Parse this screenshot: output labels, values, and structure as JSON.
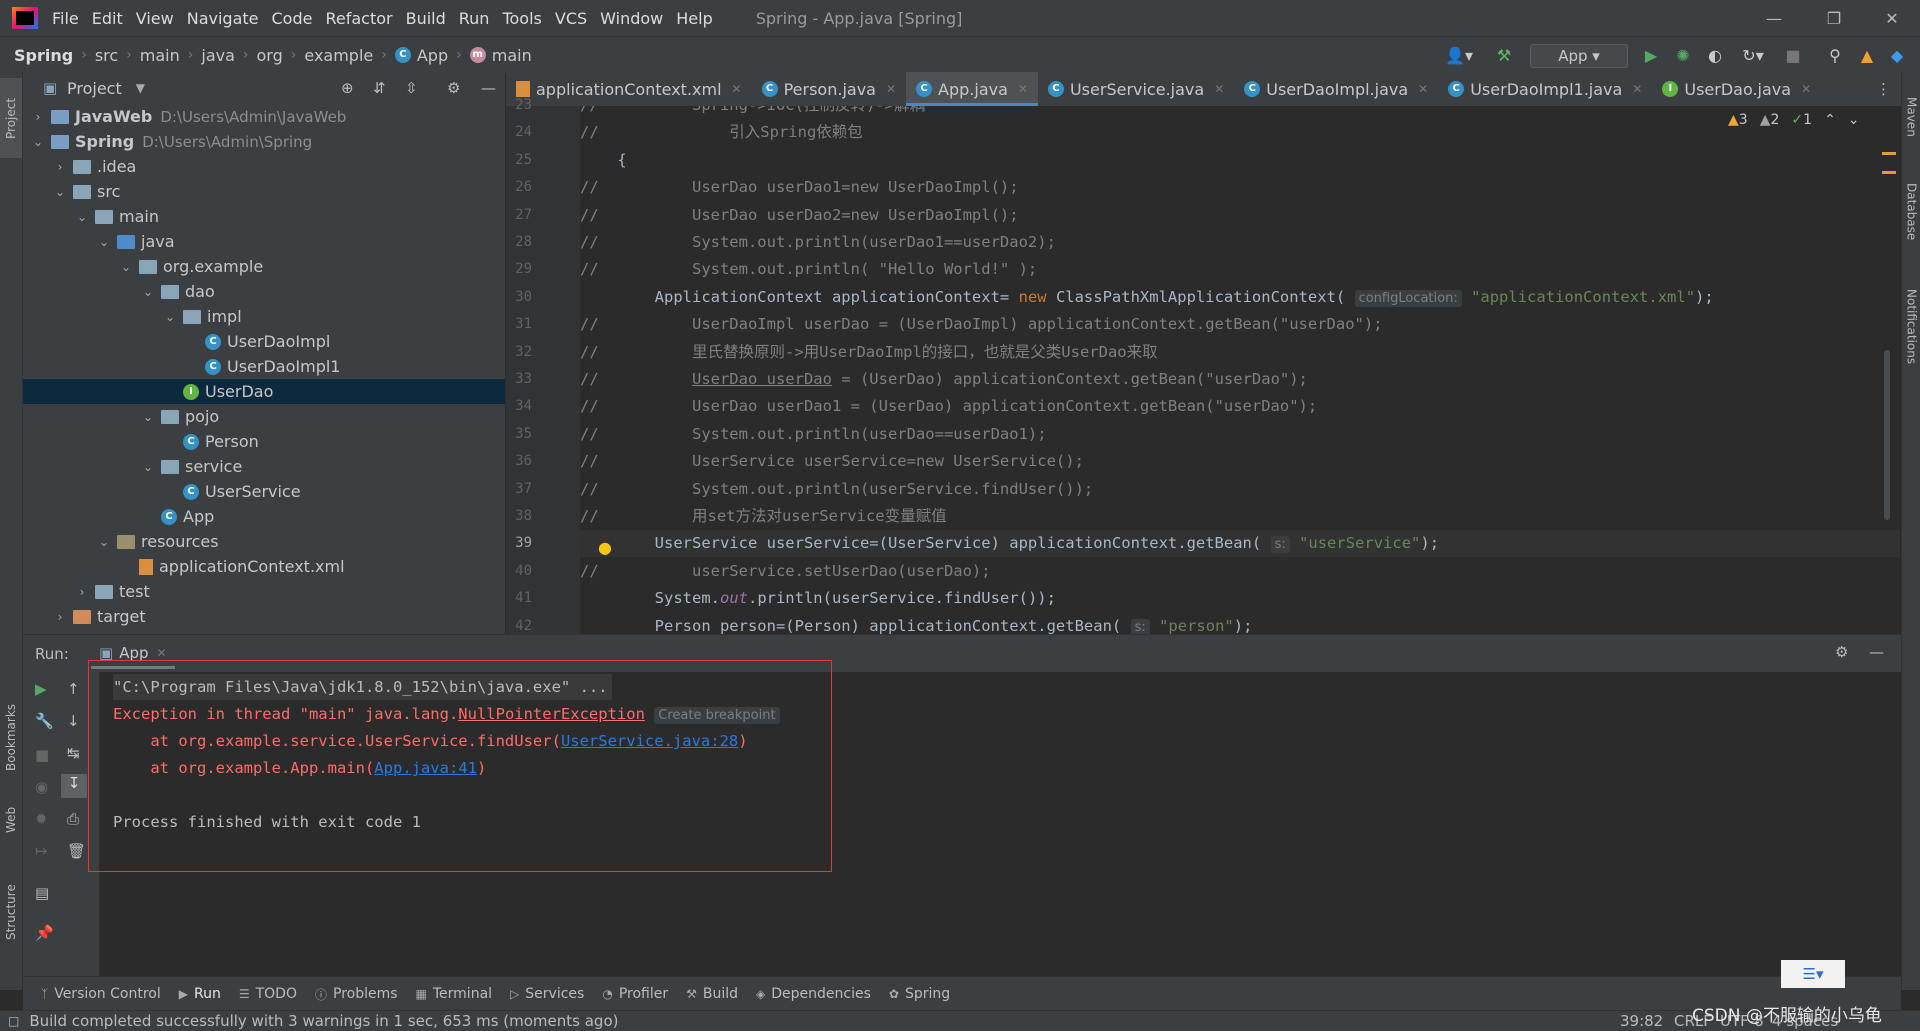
{
  "menu": [
    "File",
    "Edit",
    "View",
    "Navigate",
    "Code",
    "Refactor",
    "Build",
    "Run",
    "Tools",
    "VCS",
    "Window",
    "Help"
  ],
  "window_title": "Spring - App.java [Spring]",
  "breadcrumbs": [
    "Spring",
    "src",
    "main",
    "java",
    "org",
    "example",
    "App",
    "main"
  ],
  "run_config": "App",
  "project_panel": {
    "title": "Project",
    "tree": [
      {
        "label": "JavaWeb",
        "path": "D:\\Users\\Admin\\JavaWeb",
        "depth": 0,
        "type": "module",
        "expanded": false
      },
      {
        "label": "Spring",
        "path": "D:\\Users\\Admin\\Spring",
        "depth": 0,
        "type": "module",
        "expanded": true
      },
      {
        "label": ".idea",
        "depth": 1,
        "type": "folder",
        "expanded": false
      },
      {
        "label": "src",
        "depth": 1,
        "type": "folder",
        "expanded": true
      },
      {
        "label": "main",
        "depth": 2,
        "type": "folder",
        "expanded": true
      },
      {
        "label": "java",
        "depth": 3,
        "type": "src",
        "expanded": true
      },
      {
        "label": "org.example",
        "depth": 4,
        "type": "folder",
        "expanded": true
      },
      {
        "label": "dao",
        "depth": 5,
        "type": "folder",
        "expanded": true
      },
      {
        "label": "impl",
        "depth": 6,
        "type": "folder",
        "expanded": true
      },
      {
        "label": "UserDaoImpl",
        "depth": 7,
        "type": "class"
      },
      {
        "label": "UserDaoImpl1",
        "depth": 7,
        "type": "class"
      },
      {
        "label": "UserDao",
        "depth": 6,
        "type": "interface",
        "selected": true
      },
      {
        "label": "pojo",
        "depth": 5,
        "type": "folder",
        "expanded": true
      },
      {
        "label": "Person",
        "depth": 6,
        "type": "class"
      },
      {
        "label": "service",
        "depth": 5,
        "type": "folder",
        "expanded": true
      },
      {
        "label": "UserService",
        "depth": 6,
        "type": "class"
      },
      {
        "label": "App",
        "depth": 5,
        "type": "class"
      },
      {
        "label": "resources",
        "depth": 3,
        "type": "res",
        "expanded": true
      },
      {
        "label": "applicationContext.xml",
        "depth": 4,
        "type": "xml"
      },
      {
        "label": "test",
        "depth": 2,
        "type": "folder",
        "expanded": false
      },
      {
        "label": "target",
        "depth": 1,
        "type": "tgt",
        "expanded": false
      }
    ]
  },
  "tabs": [
    {
      "label": "applicationContext.xml",
      "icon": "xml"
    },
    {
      "label": "Person.java",
      "icon": "class"
    },
    {
      "label": "App.java",
      "icon": "class",
      "active": true
    },
    {
      "label": "UserService.java",
      "icon": "class"
    },
    {
      "label": "UserDaoImpl.java",
      "icon": "class"
    },
    {
      "label": "UserDaoImpl1.java",
      "icon": "class"
    },
    {
      "label": "UserDao.java",
      "icon": "interface"
    }
  ],
  "inspections": {
    "warnings": "3",
    "weak": "2",
    "ok": "1"
  },
  "code_lines": [
    {
      "n": "23",
      "html": "<span class=\"cm\">//          Spring->IOC(控制反转)->解耦</span>"
    },
    {
      "n": "24",
      "html": "<span class=\"cm\">//              引入Spring依赖包</span>"
    },
    {
      "n": "25",
      "html": "    {"
    },
    {
      "n": "26",
      "html": "<span class=\"cm\">//          UserDao userDao1=new UserDaoImpl();</span>"
    },
    {
      "n": "27",
      "html": "<span class=\"cm\">//          UserDao userDao2=new UserDaoImpl();</span>"
    },
    {
      "n": "28",
      "html": "<span class=\"cm\">//          System.out.println(userDao1==userDao2);</span>"
    },
    {
      "n": "29",
      "html": "<span class=\"cm\">//          System.out.println( \"Hello World!\" );</span>"
    },
    {
      "n": "30",
      "html": "        ApplicationContext applicationContext= <span class=\"kw\">new</span> ClassPathXmlApplicationContext( <span class=\"hint\">configLocation:</span> <span class=\"str\">\"applicationContext.xml\"</span>);"
    },
    {
      "n": "31",
      "html": "<span class=\"cm\">//          UserDaoImpl userDao = (UserDaoImpl) applicationContext.getBean(\"userDao\");</span>"
    },
    {
      "n": "32",
      "html": "<span class=\"cm\">//          里氏替换原则->用UserDaoImpl的接口，也就是父类UserDao来取</span>"
    },
    {
      "n": "33",
      "html": "<span class=\"cm\">//          <span class=\"ul\">UserDao userDao</span> = (UserDao) applicationContext.getBean(\"userDao\");</span>"
    },
    {
      "n": "34",
      "html": "<span class=\"cm\">//          UserDao userDao1 = (UserDao) applicationContext.getBean(\"userDao\");</span>"
    },
    {
      "n": "35",
      "html": "<span class=\"cm\">//          System.out.println(userDao==userDao1);</span>"
    },
    {
      "n": "36",
      "html": "<span class=\"cm\">//          UserService userService=new UserService();</span>"
    },
    {
      "n": "37",
      "html": "<span class=\"cm\">//          System.out.println(userService.findUser());</span>"
    },
    {
      "n": "38",
      "html": "<span class=\"cm\">//          用set方法对userService变量赋值</span>"
    },
    {
      "n": "39",
      "html": "        UserService userService=(UserService) applicationContext.getBean( <span class=\"hint\">s:</span> <span class=\"str\">\"userService\"</span>);",
      "current": true
    },
    {
      "n": "40",
      "html": "<span class=\"cm\">//          userService.setUserDao(userDao);</span>"
    },
    {
      "n": "41",
      "html": "        System.<span class=\"it\">out</span>.println(userService.findUser());"
    },
    {
      "n": "42",
      "html": "        Person person=(Person) applicationContext.getBean( <span class=\"hint\">s:</span> <span class=\"str\">\"person\"</span>);"
    }
  ],
  "run_panel": {
    "label": "Run:",
    "tab": "App",
    "console": {
      "cmd": "\"C:\\Program Files\\Java\\jdk1.8.0_152\\bin\\java.exe\" ...",
      "exc_prefix": "Exception in thread \"main\" java.lang.",
      "exc_class": "NullPointerException",
      "create_bp": "Create breakpoint",
      "at1_prefix": "    at org.example.service.UserService.findUser(",
      "at1_link": "UserService.java:28",
      "at2_prefix": "    at org.example.App.main(",
      "at2_link": "App.java:41",
      "close": ")",
      "finished": "Process finished with exit code 1"
    }
  },
  "bottom_tabs": [
    "Version Control",
    "Run",
    "TODO",
    "Problems",
    "Terminal",
    "Services",
    "Profiler",
    "Build",
    "Dependencies",
    "Spring"
  ],
  "left_stripe": [
    "Project",
    "Bookmarks",
    "Web",
    "Structure"
  ],
  "right_stripe": [
    "Maven",
    "Database",
    "Notifications"
  ],
  "status": {
    "message": "Build completed successfully with 3 warnings in 1 sec, 653 ms (moments ago)",
    "position": "39:82",
    "line_sep": "CRLF",
    "encoding": "UTF-8",
    "indent": "4 spaces",
    "watermark": "CSDN @不服输的小乌龟"
  }
}
